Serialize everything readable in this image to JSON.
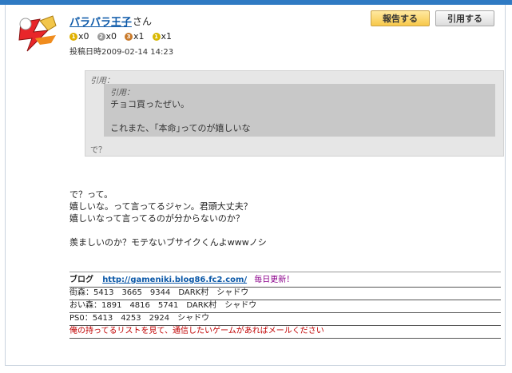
{
  "post": {
    "username": "パラパラ王子",
    "honorific": "さん",
    "medals": [
      {
        "icon": "gold-medal-icon",
        "color": "#e0b000",
        "num": "1",
        "count": "x0"
      },
      {
        "icon": "silver-medal-icon",
        "color": "#9a9a9a",
        "num": "2",
        "count": "x0"
      },
      {
        "icon": "bronze-medal-icon",
        "color": "#c97a2a",
        "num": "3",
        "count": "x1"
      },
      {
        "icon": "yellow-medal-icon",
        "color": "#d8b800",
        "num": "1",
        "count": "x1"
      }
    ],
    "posted_at": "投稿日時2009-02-14 14:23",
    "buttons": {
      "report": "報告する",
      "quote": "引用する"
    }
  },
  "quote": {
    "outer_label": "引用：",
    "inner_label": "引用：",
    "inner_line1": "チョコ買ったぜい。",
    "inner_line2": "これまた、｢本命｣ってのが嬉しいな",
    "outer_text": "で？"
  },
  "body": {
    "lines": [
      "で？って。",
      "嬉しいな。って言ってるジャン。君頭大丈夫？",
      "嬉しいなって言ってるのが分からないのか？",
      "",
      "羨ましいのか？モテないブサイクくんよwwwノシ"
    ]
  },
  "signature": {
    "blog_label": "ブログ",
    "blog_url": "http://gameniki.blog86.fc2.com/",
    "blog_note": "毎日更新！",
    "lines": [
      "街森：5413　3665　9344　DARK村　シャドウ",
      "おい森：1891　4816　5741　DARK村　シャドウ",
      "PS0：5413　4253　2924　シャドウ"
    ],
    "footer": "俺の持ってるリストを見て、通信したいゲームがあればメールください"
  },
  "colors": {
    "accent": "#2f7ac3",
    "link": "#0b58a8",
    "report_button": "#f7c84a"
  }
}
